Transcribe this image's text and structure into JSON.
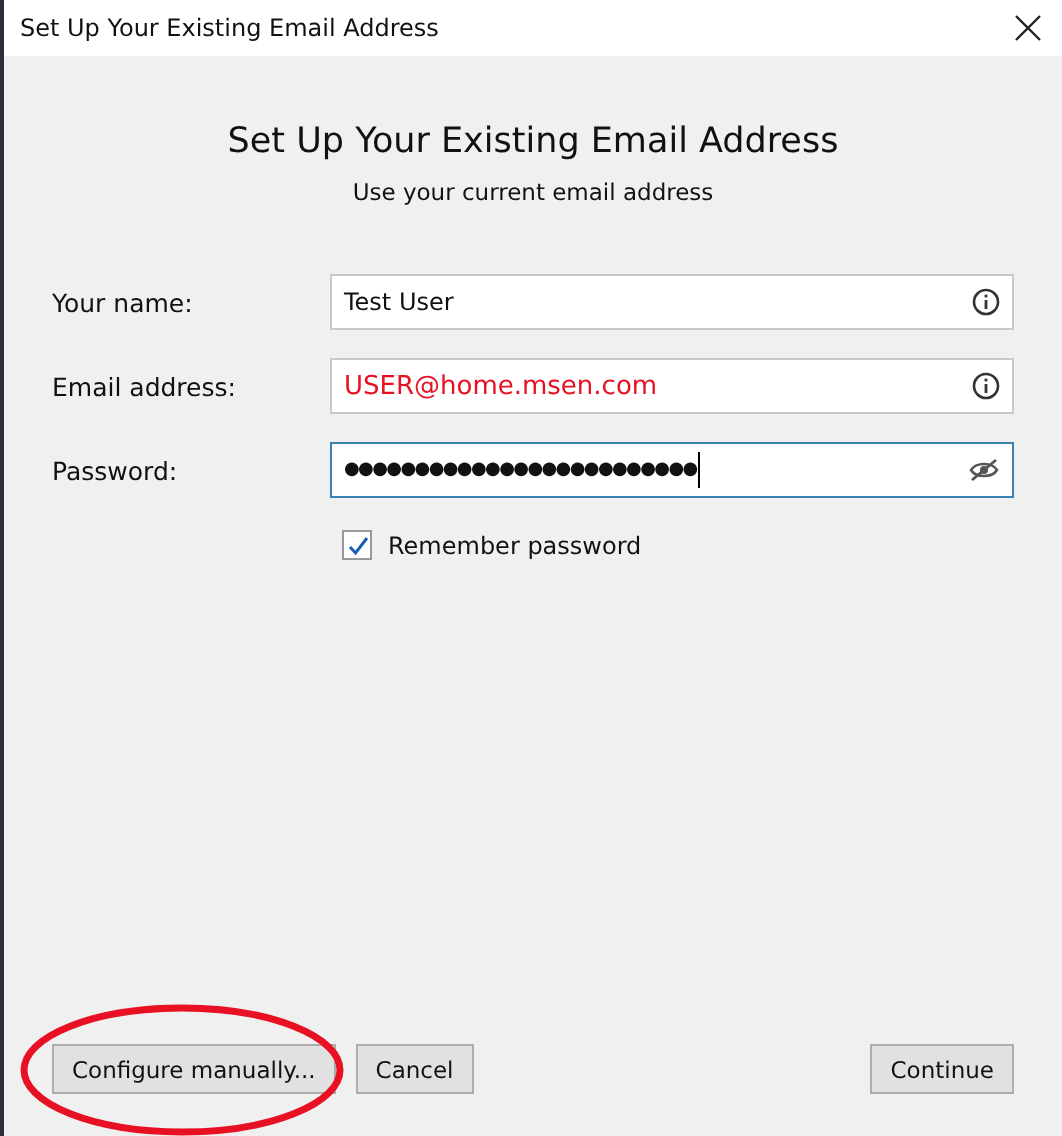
{
  "window": {
    "title": "Set Up Your Existing Email Address"
  },
  "heading": "Set Up Your Existing Email Address",
  "subheading": "Use your current email address",
  "fields": [
    {
      "label": "Your name:",
      "value": "Test User",
      "kind": "text",
      "invalid": false,
      "focused": false
    },
    {
      "label": "Email address:",
      "value": "USER@home.msen.com",
      "kind": "email",
      "invalid": true,
      "focused": false
    },
    {
      "label": "Password:",
      "value": "●●●●●●●●●●●●●●●●●●●●●●●●●",
      "kind": "password",
      "invalid": false,
      "focused": true
    }
  ],
  "remember_password": {
    "label": "Remember password",
    "checked": true
  },
  "buttons": [
    {
      "label": "Configure manually...",
      "circled": true
    },
    {
      "label": "Cancel",
      "circled": false
    },
    {
      "label": "Continue",
      "circled": false
    }
  ]
}
